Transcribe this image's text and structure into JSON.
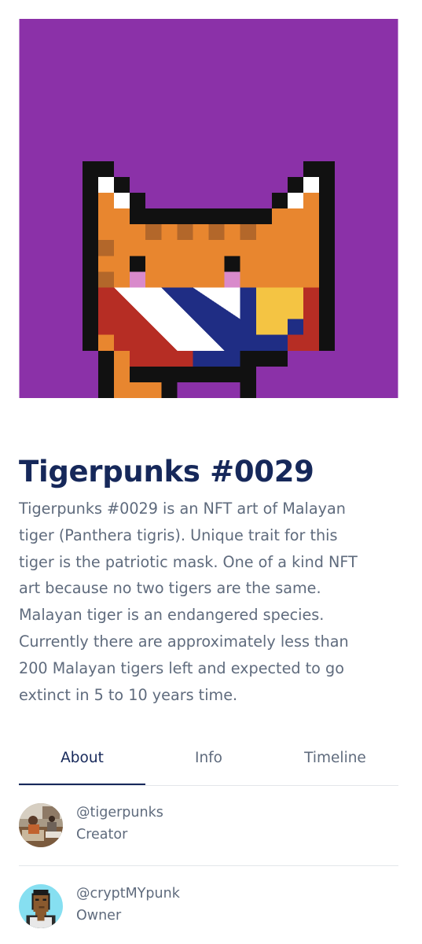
{
  "nft": {
    "title": "Tigerpunks #0029",
    "description_lines": [
      "Tigerpunks #0029 is an NFT art of Malayan",
      "tiger (Panthera tigris). Unique trait for this",
      "tiger is the patriotic mask. One of a kind NFT",
      "art because no two tigers are the same.",
      "Malayan tiger is an endangered species.",
      "Currently there are approximately less than",
      "200 Malayan tigers left and expected to go",
      "extinct in 5 to 10 years time."
    ]
  },
  "tabs": [
    {
      "label": "About",
      "active": true
    },
    {
      "label": "Info",
      "active": false
    },
    {
      "label": "Timeline",
      "active": false
    }
  ],
  "people": [
    {
      "handle": "@tigerpunks",
      "role": "Creator",
      "avatar": "photo-avatar"
    },
    {
      "handle": "@cryptMYpunk",
      "role": "Owner",
      "avatar": "pixel-punk-avatar"
    }
  ],
  "colors": {
    "background_artwork": "#8b31a8",
    "title": "#16285a",
    "body_text": "#5f6b7d",
    "tab_indicator": "#16285a",
    "divider": "#e3e6ea",
    "tiger_orange": "#e8862f",
    "mask_red": "#b62d24",
    "mask_blue": "#1f2d84",
    "mask_yellow": "#f4c443"
  }
}
